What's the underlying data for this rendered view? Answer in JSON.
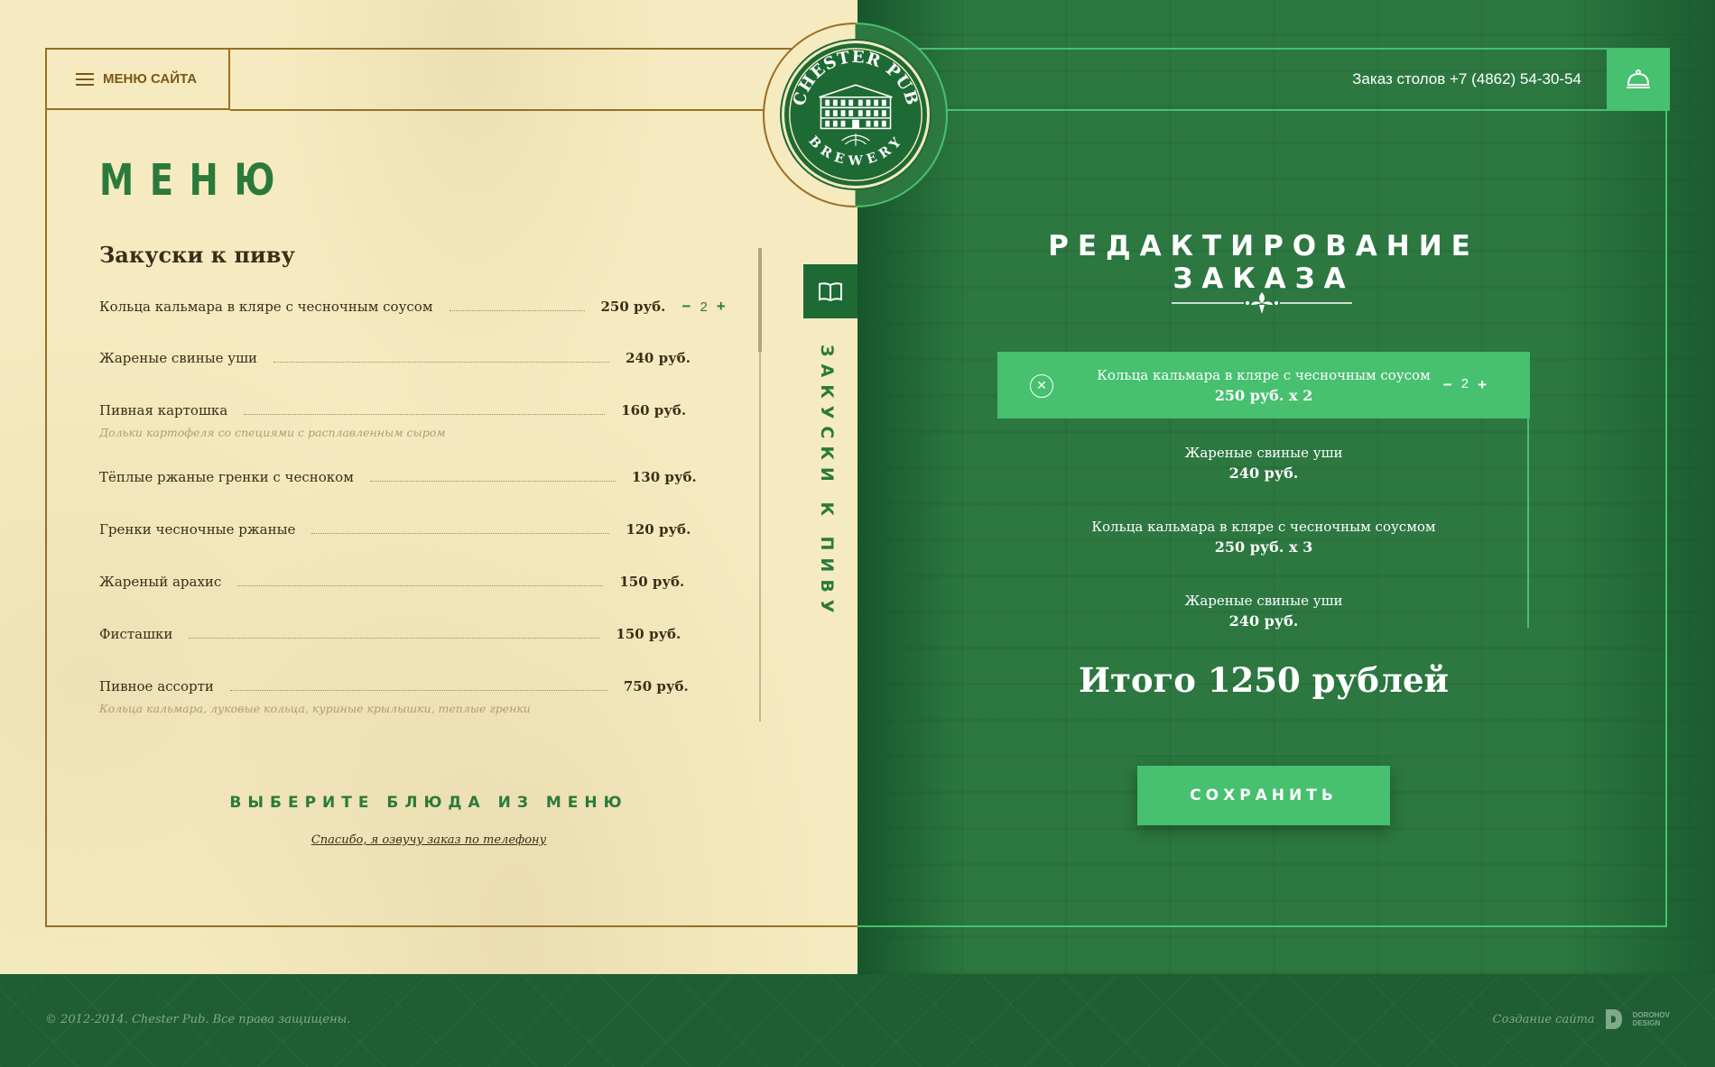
{
  "header": {
    "menu_button_label": "МЕНЮ САЙТА",
    "reserve_text": "Заказ столов +7 (4862) 54-30-54",
    "bell_icon": "service-bell-icon"
  },
  "logo": {
    "top_text": "CHESTER PUB",
    "bottom_text": "BREWERY"
  },
  "menu": {
    "title": "МЕНЮ",
    "section_title": "Закуски к пиву",
    "category_tab_label": "ЗАКУСКИ К ПИВУ",
    "items": [
      {
        "name": "Кольца кальмара в кляре с чесночным соусом",
        "price": "250 руб.",
        "qty": "2",
        "dots_w": 150
      },
      {
        "name": "Жареные свиные уши",
        "price": "240 руб.",
        "dots_w": 372
      },
      {
        "name": "Пивная картошка",
        "price": "160 руб.",
        "desc": "Дольки картофеля со специями с расплавленным сыром",
        "dots_w": 400
      },
      {
        "name": "Тёплые ржаные гренки с чесноком",
        "price": "130 руб.",
        "dots_w": 272
      },
      {
        "name": "Гренки чесночные ржаные",
        "price": "120 руб.",
        "dots_w": 330
      },
      {
        "name": "Жареный арахис",
        "price": "150 руб.",
        "dots_w": 405
      },
      {
        "name": "Фисташки",
        "price": "150 руб.",
        "dots_w": 455
      },
      {
        "name": "Пивное ассорти",
        "price": "750 руб.",
        "desc": "Кольца кальмара, луковые кольца, куриные крылышки, теплые гренки",
        "dots_w": 418
      }
    ],
    "choose_title": "ВЫБЕРИТЕ БЛЮДА ИЗ МЕНЮ",
    "phone_link": "Спасибо, я озвучу заказ по телефону"
  },
  "order": {
    "title": "РЕДАКТИРОВАНИЕ ЗАКАЗА",
    "items": [
      {
        "name": "Кольца кальмара в кляре с чесночным соусом",
        "price": "250 руб. x 2",
        "qty": "2",
        "active": true
      },
      {
        "name": "Жареные свиные уши",
        "price": "240 руб."
      },
      {
        "name": "Кольца кальмара в кляре с чесночным соусмом",
        "price": "250 руб. x 3"
      },
      {
        "name": "Жареные свиные уши",
        "price": "240 руб."
      }
    ],
    "total": "Итого 1250 рублей",
    "save_label": "СОХРАНИТЬ"
  },
  "footer": {
    "copyright": "© 2012-2014. Chester Pub. Все права защищены.",
    "credits": "Создание сайта",
    "dev_logo_line1": "DOROHOV",
    "dev_logo_line2": "DESIGN"
  },
  "colors": {
    "cream": "#f6ebc0",
    "green_dark": "#1e6a35",
    "green_accent": "#47c06f",
    "gold": "#9a6e25"
  }
}
